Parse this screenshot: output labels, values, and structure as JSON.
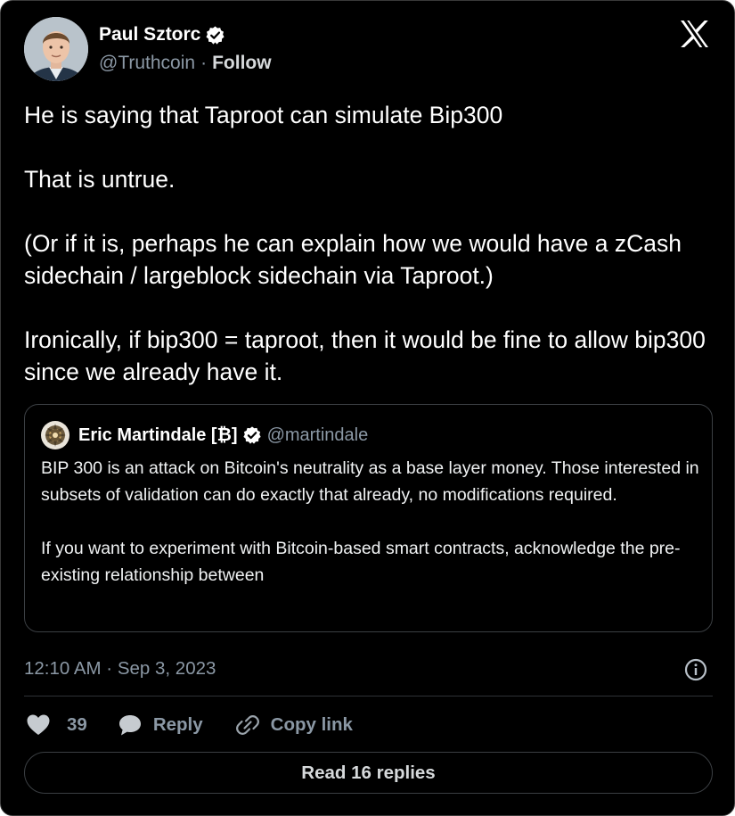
{
  "author": {
    "name": "Paul Sztorc",
    "handle": "@Truthcoin",
    "separator": "·",
    "follow_label": "Follow",
    "verified": true
  },
  "tweet": {
    "paragraphs": [
      "He is saying that Taproot can simulate Bip300",
      "That is untrue.",
      "(Or if it is, perhaps he can explain how we would have a zCash sidechain / largeblock sidechain via Taproot.)",
      "Ironically, if bip300 = taproot, then it would be fine to allow bip300 since we already have it."
    ]
  },
  "quote": {
    "name": "Eric Martindale [₿]",
    "handle": "@martindale",
    "verified": true,
    "paragraphs": [
      "BIP 300 is an attack on Bitcoin's neutrality as a base layer money.  Those interested in subsets of validation can do exactly that already, no modifications required.",
      "If you want to experiment with Bitcoin-based smart contracts, acknowledge the pre-existing relationship between"
    ]
  },
  "timestamp": "12:10 AM · Sep 3, 2023",
  "actions": {
    "like_count": "39",
    "reply_label": "Reply",
    "copy_link_label": "Copy link"
  },
  "read_replies_label": "Read 16 replies",
  "icons": {
    "x_logo": "x-logo-icon",
    "verified": "verified-badge-icon",
    "info": "info-icon",
    "heart": "heart-icon",
    "reply": "reply-bubble-icon",
    "link": "link-icon"
  },
  "colors": {
    "background": "#000000",
    "text_primary": "#ffffff",
    "text_secondary": "#8b98a5",
    "border": "#3b3f43"
  }
}
